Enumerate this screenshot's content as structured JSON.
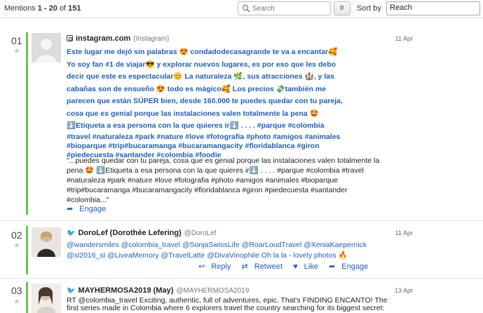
{
  "header": {
    "mentions_prefix": "Mentions",
    "range": "1 - 20",
    "of_text": "of",
    "total": "151",
    "search_placeholder": "Search",
    "search_button": "Ir",
    "sort_label": "Sort by",
    "sort_value": "Reach"
  },
  "mentions": [
    {
      "number": "01",
      "source_name": "instagram.com",
      "source_handle": "(Instagram)",
      "source_icon": "instagram-icon",
      "date": "11 Apr",
      "bold_lines": [
        "Este lugar me dejó sin palabras 😍 condadodecasagrande te va a encantar🥰",
        "Yo soy fan #1 de viajar😎 y explorar nuevos lugares, es por eso que les debo",
        "decir que este es espectacular😊 La naturaleza 🌿, sus atracciones 🏰, y las",
        "cabañas son de ensueño 😍 todo es mágico🥰 Los precios 💸también me",
        "parecen que están SÚPER bien, desde 160.000 te puedes quedar con tu pareja,",
        "cosa que es genial porque las instalaciones valen totalmente la pena 🤩",
        "⬇️Etiqueta a esa persona con la que quieres ir⬇️ . . . . #parque #colombia",
        "#travel #naturaleza #park #nature #love #fotografia #photo #amigos #animales",
        "#bioparque #trip#bucaramanga #bucaramangacity #floridablanca #giron",
        "#piedecuesta #santander #colombia #foodie"
      ],
      "excerpt_lines": [
        "\"...puedes quedar con tu pareja, cosa que es genial porque las instalaciones valen totalmente la",
        "pena 🤩 ⬇️Etiqueta a esa persona con la que quieres ir⬇️ . . . . #parque #colombia #travel",
        "#naturaleza #park #nature #love #fotografia #photo #amigos #animales #bioparque",
        "#trip#bucaramanga #bucaramangacity #floridablanca #giron #piedecuesta #santander",
        "#colombia...\""
      ],
      "actions": [
        "Engage"
      ]
    },
    {
      "number": "02",
      "source_name": "DoroLef (Dorothée Lefering)",
      "source_handle": "@DoroLef",
      "source_icon": "twitter-icon",
      "date": "11 Apr",
      "text_lines": [
        "@wandersmiles @colombia_travel @SonjaSwissLife @RoarLoudTravel @XeniaKaepernick",
        "@sl2016_sl @LiveaMemory @TravelLatte @DivaVinophile Oh la la - lovely photos 🔥"
      ],
      "actions": [
        "Reply",
        "Retweet",
        "Like",
        "Engage"
      ]
    },
    {
      "number": "03",
      "source_name": "MAYHERMOSA2019 (May)",
      "source_handle": "@MAYHERMOSA2019",
      "source_icon": "twitter-icon",
      "date": "13 Apr",
      "text_lines": [
        "RT @colombia_travel Exciting, authentic, full of adventures, epic. That's FINDING ENCANTO! The",
        "first series made in Colombia where 6 explorers travel the country searching for its biggest secret:"
      ]
    }
  ],
  "colors": {
    "accent_green": "#6cc24a",
    "link_blue": "#1f5fbf"
  }
}
